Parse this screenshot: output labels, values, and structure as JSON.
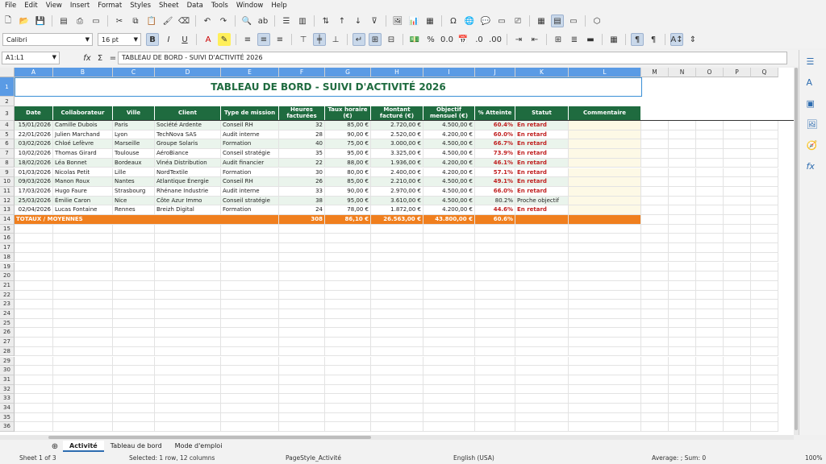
{
  "menu": [
    "File",
    "Edit",
    "View",
    "Insert",
    "Format",
    "Styles",
    "Sheet",
    "Data",
    "Tools",
    "Window",
    "Help"
  ],
  "font": {
    "name": "Calibri",
    "size": "16 pt"
  },
  "namebox": "A1:L1",
  "formula": "TABLEAU DE BORD - SUIVI D'ACTIVITÉ 2026",
  "columns": [
    "A",
    "B",
    "C",
    "D",
    "E",
    "F",
    "G",
    "H",
    "I",
    "J",
    "K",
    "L",
    "M",
    "N",
    "O",
    "P",
    "Q"
  ],
  "title": "TABLEAU DE BORD - SUIVI D'ACTIVITÉ 2026",
  "headers": [
    "Date",
    "Collaborateur",
    "Ville",
    "Client",
    "Type de mission",
    "Heures facturées",
    "Taux horaire (€)",
    "Montant facturé (€)",
    "Objectif mensuel (€)",
    "% Atteinte",
    "Statut",
    "Commentaire"
  ],
  "rows": [
    [
      "15/01/2026",
      "Camille Dubois",
      "Paris",
      "Société Ardente",
      "Conseil RH",
      "32",
      "85,00 €",
      "2.720,00 €",
      "4.500,00 €",
      "60.4%",
      "En retard"
    ],
    [
      "22/01/2026",
      "Julien Marchand",
      "Lyon",
      "TechNova SAS",
      "Audit interne",
      "28",
      "90,00 €",
      "2.520,00 €",
      "4.200,00 €",
      "60.0%",
      "En retard"
    ],
    [
      "03/02/2026",
      "Chloé Lefèvre",
      "Marseille",
      "Groupe Solaris",
      "Formation",
      "40",
      "75,00 €",
      "3.000,00 €",
      "4.500,00 €",
      "66.7%",
      "En retard"
    ],
    [
      "10/02/2026",
      "Thomas Girard",
      "Toulouse",
      "AéroBiance",
      "Conseil stratégie",
      "35",
      "95,00 €",
      "3.325,00 €",
      "4.500,00 €",
      "73.9%",
      "En retard"
    ],
    [
      "18/02/2026",
      "Léa Bonnet",
      "Bordeaux",
      "Vinéa Distribution",
      "Audit financier",
      "22",
      "88,00 €",
      "1.936,00 €",
      "4.200,00 €",
      "46.1%",
      "En retard"
    ],
    [
      "01/03/2026",
      "Nicolas Petit",
      "Lille",
      "NordTextile",
      "Formation",
      "30",
      "80,00 €",
      "2.400,00 €",
      "4.200,00 €",
      "57.1%",
      "En retard"
    ],
    [
      "09/03/2026",
      "Manon Roux",
      "Nantes",
      "Atlantique Énergie",
      "Conseil RH",
      "26",
      "85,00 €",
      "2.210,00 €",
      "4.500,00 €",
      "49.1%",
      "En retard"
    ],
    [
      "17/03/2026",
      "Hugo Faure",
      "Strasbourg",
      "Rhénane Industrie",
      "Audit interne",
      "33",
      "90,00 €",
      "2.970,00 €",
      "4.500,00 €",
      "66.0%",
      "En retard"
    ],
    [
      "25/03/2026",
      "Émilie Caron",
      "Nice",
      "Côte Azur Immo",
      "Conseil stratégie",
      "38",
      "95,00 €",
      "3.610,00 €",
      "4.500,00 €",
      "80.2%",
      "Proche objectif"
    ],
    [
      "02/04/2026",
      "Lucas Fontaine",
      "Rennes",
      "Breizh Digital",
      "Formation",
      "24",
      "78,00 €",
      "1.872,00 €",
      "4.200,00 €",
      "44.6%",
      "En retard"
    ]
  ],
  "totals": {
    "label": "TOTAUX / MOYENNES",
    "hours": "308",
    "rate": "86,10 €",
    "amount": "26.563,00 €",
    "objective": "43.800,00 €",
    "pct": "60.6%"
  },
  "tabs": [
    "Activité",
    "Tableau de bord",
    "Mode d'emploi"
  ],
  "status": {
    "sheet": "Sheet 1 of 3",
    "selected": "Selected: 1 row, 12 columns",
    "pagestyle": "PageStyle_Activité",
    "lang": "English (USA)",
    "sum": "Average: ; Sum: 0",
    "zoom": "100%"
  }
}
